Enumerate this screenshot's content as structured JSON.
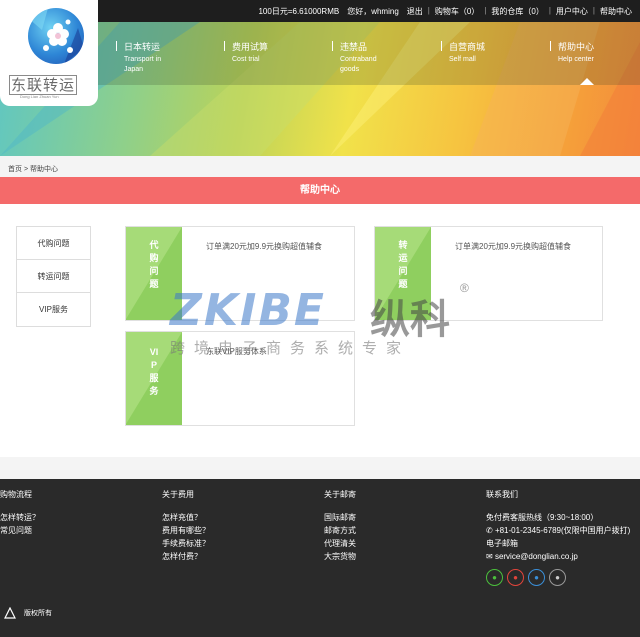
{
  "topbar": {
    "rate": "100日元=6.61000RMB",
    "greeting": "您好，whming",
    "logout": "退出",
    "cart": "购物车（0）",
    "warehouse": "我的仓库（0）",
    "user_center": "用户中心",
    "help_center": "帮助中心"
  },
  "logo": {
    "name": "东联转运",
    "pinyin": "Dong Lian Zhuan Yun"
  },
  "nav": [
    {
      "cn": "日本转运",
      "en": "Transport in Japan"
    },
    {
      "cn": "费用试算",
      "en": "Cost trial"
    },
    {
      "cn": "违禁品",
      "en": "Contraband goods"
    },
    {
      "cn": "自营商城",
      "en": "Self mall"
    },
    {
      "cn": "帮助中心",
      "en": "Help center"
    }
  ],
  "breadcrumb": {
    "home": "首页",
    "sep": ">",
    "current": "帮助中心"
  },
  "page_title": "帮助中心",
  "sidebar": {
    "items": [
      {
        "label": "代购问题"
      },
      {
        "label": "转运问题"
      },
      {
        "label": "VIP服务"
      }
    ]
  },
  "cards": [
    {
      "label": "代购问题",
      "text": "订单满20元加9.9元换购超值辅食"
    },
    {
      "label": "转运问题",
      "text": "订单满20元加9.9元换购超值辅食"
    },
    {
      "label": "VIP服务",
      "text": "东联VIP服务体系"
    }
  ],
  "watermark": {
    "brand": "ZKIBE",
    "brand_cn": "纵科",
    "reg": "®",
    "tagline": "跨境电子商务系统专家"
  },
  "footer": {
    "col1": {
      "title": "购物流程",
      "items": [
        "怎样转运？",
        "常见问题"
      ]
    },
    "col2": {
      "title": "关于费用",
      "items": [
        "怎样充值？",
        "费用有哪些？",
        "手续费标准？",
        "怎样付费？"
      ]
    },
    "col3": {
      "title": "关于邮寄",
      "items": [
        "国际邮寄",
        "邮寄方式",
        "代理清关",
        "大宗货物"
      ]
    },
    "col4": {
      "title": "联系我们",
      "hotline": "免付费客服热线（9:30~18:00）",
      "phone": "+81-01-2345-6789(仅限中国用户拨打)",
      "email_label": "电子邮箱",
      "email": "service@donglian.co.jp"
    },
    "copyright": "版权所有"
  }
}
